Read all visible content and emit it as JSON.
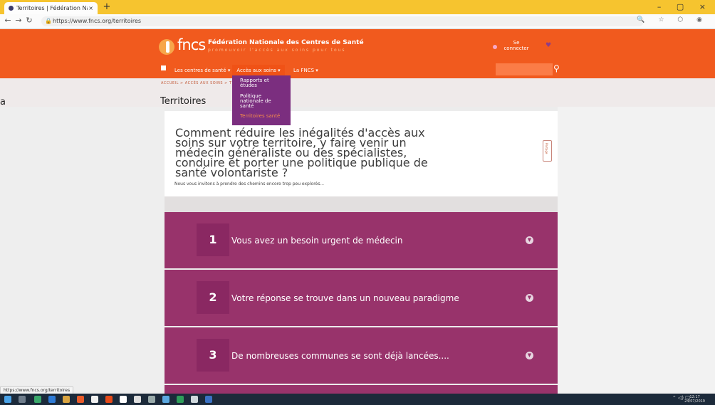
{
  "browser": {
    "tab_title": "Territoires | Fédération Nationale",
    "tab_close": "×",
    "new_tab": "+",
    "url": "https://www.fncs.org/territoires",
    "window_controls": "–  ▢  ×",
    "icons": "🔍 ☆ ⬡ ◉"
  },
  "header": {
    "logo_text": "fncs",
    "org_name": "Fédération Nationale des Centres de Santé",
    "tagline": "promouvoir l'accès aux soins pour tous",
    "connect": "Se connecter",
    "heart": "♥"
  },
  "nav": {
    "items": [
      "Les centres de santé ▾",
      "Accès aux soins ▾",
      "La FNCS ▾"
    ],
    "search_placeholder": "",
    "search_icon": "⚲"
  },
  "breadcrumb": "ACCUEIL  >  ACCÈS AUX SOINS  >  TER",
  "page": {
    "title": "Territoires",
    "left_fragment": "a"
  },
  "dropdown": {
    "items": [
      "Rapports et études",
      "Politique nationale de santé",
      "Territoires santé"
    ]
  },
  "content": {
    "question": "Comment réduire les inégalités d'accès aux soins sur votre territoire, y faire venir un médecin généraliste ou des spécialistes, conduire et porter une politique publique de santé volontariste ?",
    "subtitle": "Nous vous invitons à prendre des chemins encore trop peu explorés...",
    "scroll_label": "Partage"
  },
  "accordion": [
    {
      "num": "1",
      "label": "Vous avez un besoin urgent de médecin"
    },
    {
      "num": "2",
      "label": "Votre réponse se trouve dans un nouveau paradigme"
    },
    {
      "num": "3",
      "label": "De nombreuses communes se sont déjà lancées...."
    }
  ],
  "status_url": "https://www.fncs.org/territoires",
  "taskbar": {
    "tray": "⌃ ◁) 🖵",
    "time": "12:17",
    "date": "24/07/2019"
  },
  "colors": {
    "tabstrip": "#f6c42f",
    "header": "#f15a1e",
    "accordion": "#98336b",
    "dropdown": "#7b2e7f"
  }
}
